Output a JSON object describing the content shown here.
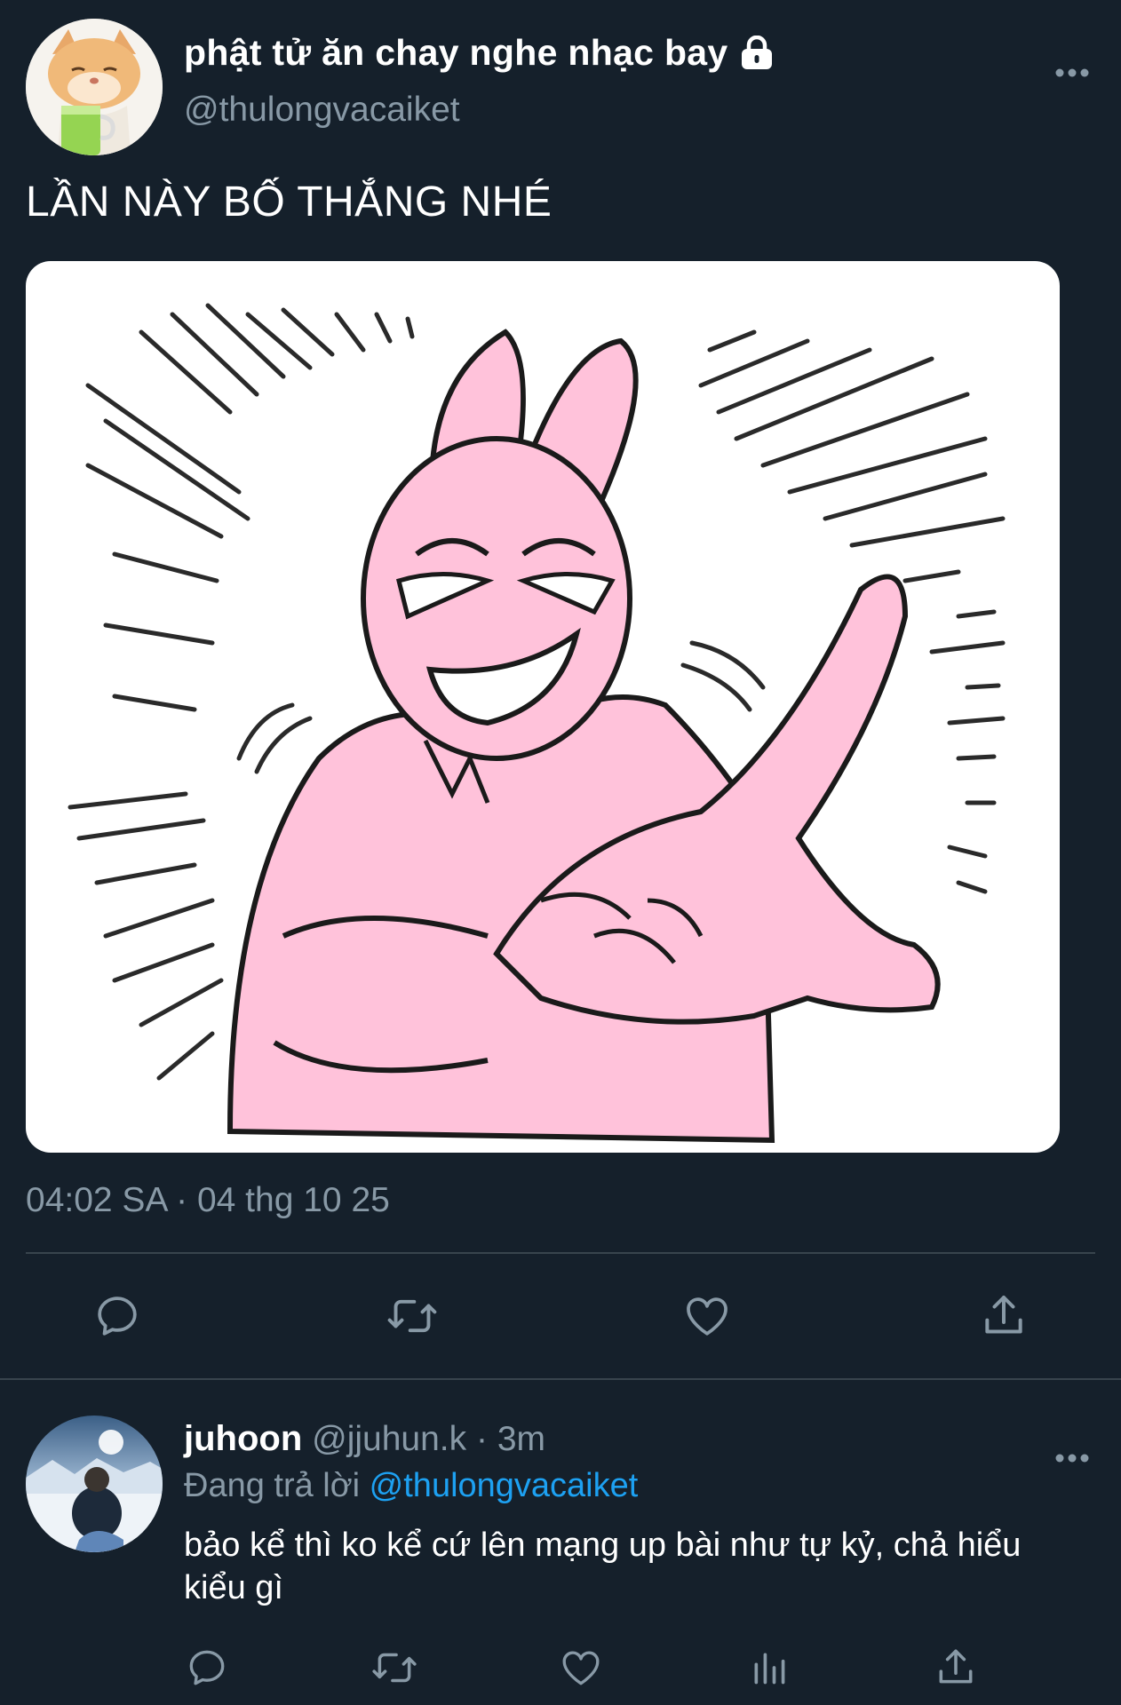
{
  "tweet": {
    "display_name": "phật tử ăn chay nghe nhạc bay",
    "handle": "@thulongvacaiket",
    "text": "LẦN NÀY BỐ THẮNG NHÉ",
    "timestamp": "04:02 SA · 04 thg 10 25",
    "icons": [
      "lock-icon",
      "more-icon",
      "reply-icon",
      "retweet-icon",
      "like-icon",
      "share-icon"
    ]
  },
  "reply": {
    "name": "juhoon",
    "handle": "@jjuhun.k",
    "separator": "·",
    "time": "3m",
    "replying_label": "Đang trả lời",
    "replying_to": "@thulongvacaiket",
    "text": "bảo kể thì ko kể cứ lên mạng up bài như tự kỷ, chả hiểu kiểu gì",
    "icons": [
      "reply-icon",
      "retweet-icon",
      "like-icon",
      "analytics-icon",
      "share-icon"
    ]
  },
  "colors": {
    "background": "#15202b",
    "muted_text": "#8899a6",
    "link": "#1da1f2",
    "divider": "#38444d",
    "sticker_pink": "#ffc2da"
  }
}
